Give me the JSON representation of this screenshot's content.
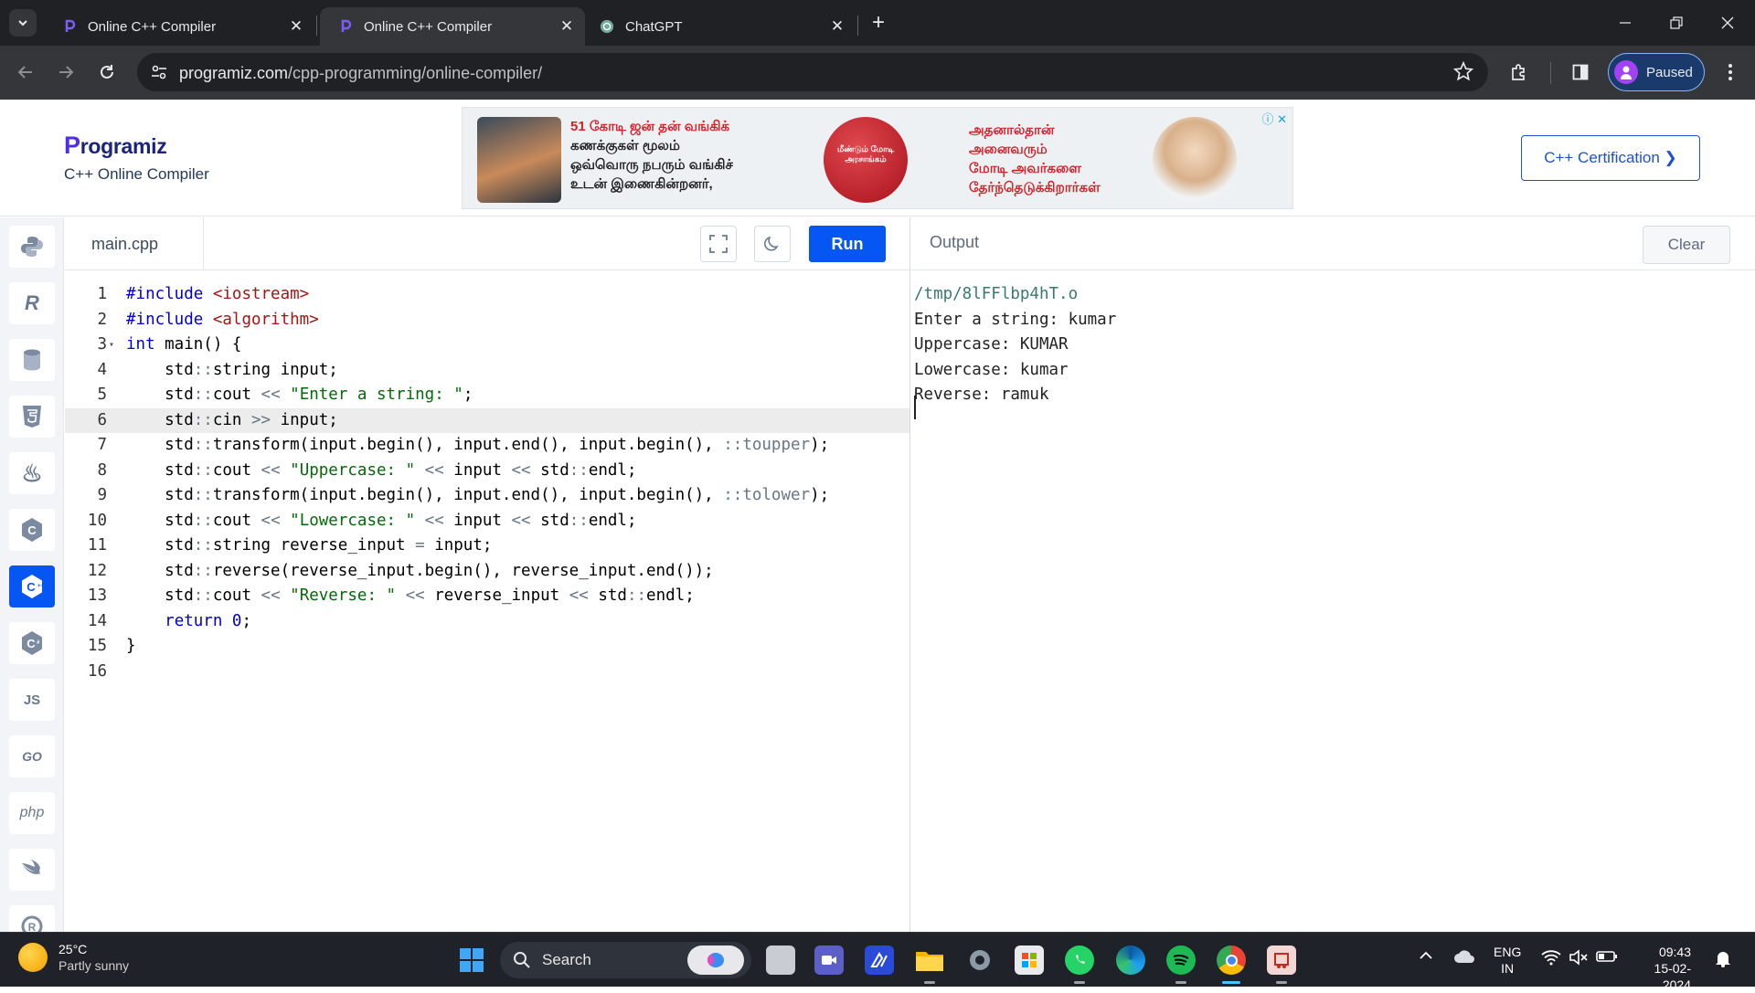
{
  "browser": {
    "tabs": [
      {
        "title": "Online C++ Compiler",
        "active": false
      },
      {
        "title": "Online C++ Compiler",
        "active": true
      },
      {
        "title": "ChatGPT",
        "active": false
      }
    ],
    "url_host": "programiz.com",
    "url_path": "/cpp-programming/online-compiler/",
    "profile_label": "Paused"
  },
  "header": {
    "brand": "rogramiz",
    "brand_initial": "P",
    "subtitle": "C++ Online Compiler",
    "certification_button": "C++ Certification ❯",
    "ad": {
      "left_text": [
        "51 கோடி ஜன் தன் வங்கிக்",
        "கணக்குகள் மூலம்",
        "ஒவ்வொரு நபரும் வங்கிச்",
        "உடன் இணைகின்றனர்,"
      ],
      "right_text": [
        "அதனால்தான்",
        "அனைவரும்",
        "மோடி அவர்களை",
        "தேர்ந்தெடுக்கிறார்கள்"
      ],
      "seal_text": "மீண்டும் மோடி அரசாங்கம்",
      "info_marker": "ⓘ ✕"
    }
  },
  "sidebar": {
    "languages": [
      {
        "name": "python",
        "label": "",
        "active": false
      },
      {
        "name": "r",
        "label": "R",
        "active": false
      },
      {
        "name": "sql",
        "label": "",
        "active": false
      },
      {
        "name": "html",
        "label": "5",
        "active": false
      },
      {
        "name": "java",
        "label": "♨",
        "active": false
      },
      {
        "name": "c",
        "label": "C",
        "active": false
      },
      {
        "name": "cpp",
        "label": "C",
        "active": true
      },
      {
        "name": "csharp",
        "label": "C",
        "active": false
      },
      {
        "name": "javascript",
        "label": "JS",
        "active": false
      },
      {
        "name": "go",
        "label": "GO",
        "active": false
      },
      {
        "name": "php",
        "label": "php",
        "active": false
      },
      {
        "name": "swift",
        "label": "",
        "active": false
      },
      {
        "name": "rust",
        "label": "R",
        "active": false
      }
    ]
  },
  "editor": {
    "filename": "main.cpp",
    "run_label": "Run",
    "current_line": 6,
    "lines": [
      "#include <iostream>",
      "#include <algorithm>",
      "int main() {",
      "    std::string input;",
      "    std::cout << \"Enter a string: \";",
      "    std::cin >> input;",
      "    std::transform(input.begin(), input.end(), input.begin(), ::toupper);",
      "    std::cout << \"Uppercase: \" << input << std::endl;",
      "    std::transform(input.begin(), input.end(), input.begin(), ::tolower);",
      "    std::cout << \"Lowercase: \" << input << std::endl;",
      "    std::string reverse_input = input;",
      "    std::reverse(reverse_input.begin(), reverse_input.end());",
      "    std::cout << \"Reverse: \" << reverse_input << std::endl;",
      "    return 0;",
      "}",
      ""
    ]
  },
  "output": {
    "title": "Output",
    "clear_label": "Clear",
    "lines": [
      "/tmp/8lFFlbp4hT.o",
      "Enter a string: kumar",
      "Uppercase: KUMAR",
      "Lowercase: kumar",
      "Reverse: ramuk"
    ]
  },
  "taskbar": {
    "temperature": "25°C",
    "weather": "Partly sunny",
    "search_placeholder": "Search",
    "language_line1": "ENG",
    "language_line2": "IN",
    "time": "09:43",
    "date": "15-02-2024"
  },
  "colors": {
    "accent": "#0556f3",
    "brand": "#4e2ee8"
  }
}
